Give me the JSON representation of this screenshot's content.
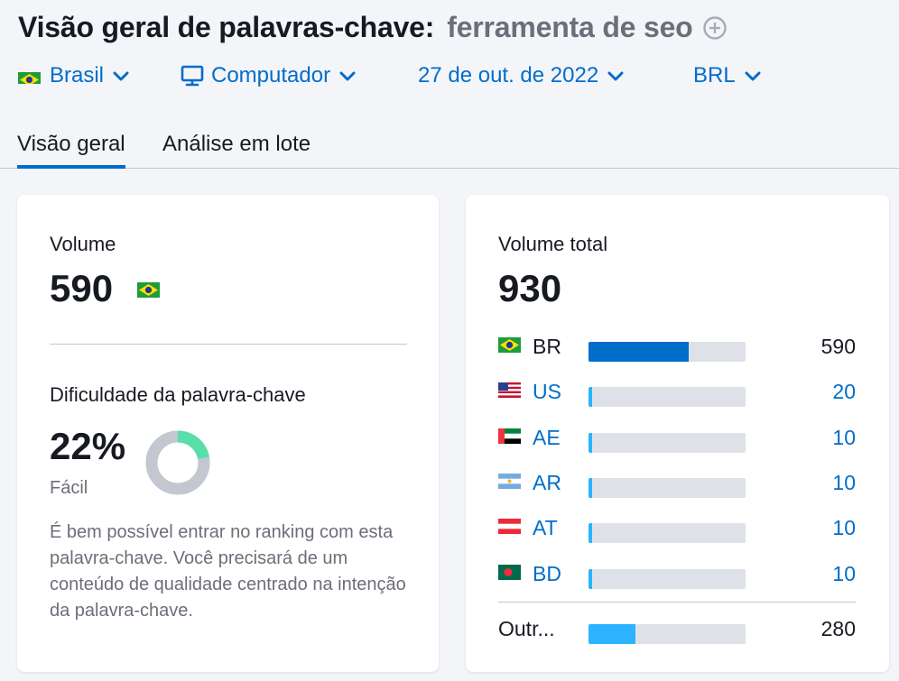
{
  "header": {
    "title": "Visão geral de palavras-chave:",
    "keyword": "ferramenta de seo"
  },
  "filters": {
    "country": "Brasil",
    "device": "Computador",
    "date": "27 de out. de 2022",
    "currency": "BRL"
  },
  "tabs": [
    {
      "label": "Visão geral",
      "active": true
    },
    {
      "label": "Análise em lote",
      "active": false
    }
  ],
  "volume_card": {
    "label": "Volume",
    "value": "590",
    "difficulty_label": "Dificuldade da palavra-chave",
    "difficulty_value": "22%",
    "difficulty_fraction": 0.22,
    "difficulty_level": "Fácil",
    "description": "É bem possível entrar no ranking com esta palavra-chave. Você precisará de um conteúdo de qualidade centrado na intenção da palavra-chave."
  },
  "total_card": {
    "label": "Volume total",
    "value": "930",
    "countries": [
      {
        "code": "BR",
        "value": "590",
        "fraction": 0.64,
        "flag": "brazil-flag",
        "link": false
      },
      {
        "code": "US",
        "value": "20",
        "fraction": 0.025,
        "flag": "usa-flag",
        "link": true
      },
      {
        "code": "AE",
        "value": "10",
        "fraction": 0.02,
        "flag": "uae-flag",
        "link": true
      },
      {
        "code": "AR",
        "value": "10",
        "fraction": 0.02,
        "flag": "argentina-flag",
        "link": true
      },
      {
        "code": "AT",
        "value": "10",
        "fraction": 0.02,
        "flag": "austria-flag",
        "link": true
      },
      {
        "code": "BD",
        "value": "10",
        "fraction": 0.02,
        "flag": "bangladesh-flag",
        "link": true
      }
    ],
    "other": {
      "label": "Outr...",
      "value": "280",
      "fraction": 0.3
    }
  },
  "colors": {
    "accent": "#006dca",
    "bar_bg": "#dfe1e8",
    "other_bar": "#2bb3ff",
    "difficulty_green": "#59dda9",
    "donut_gray": "#c2c7d0"
  }
}
